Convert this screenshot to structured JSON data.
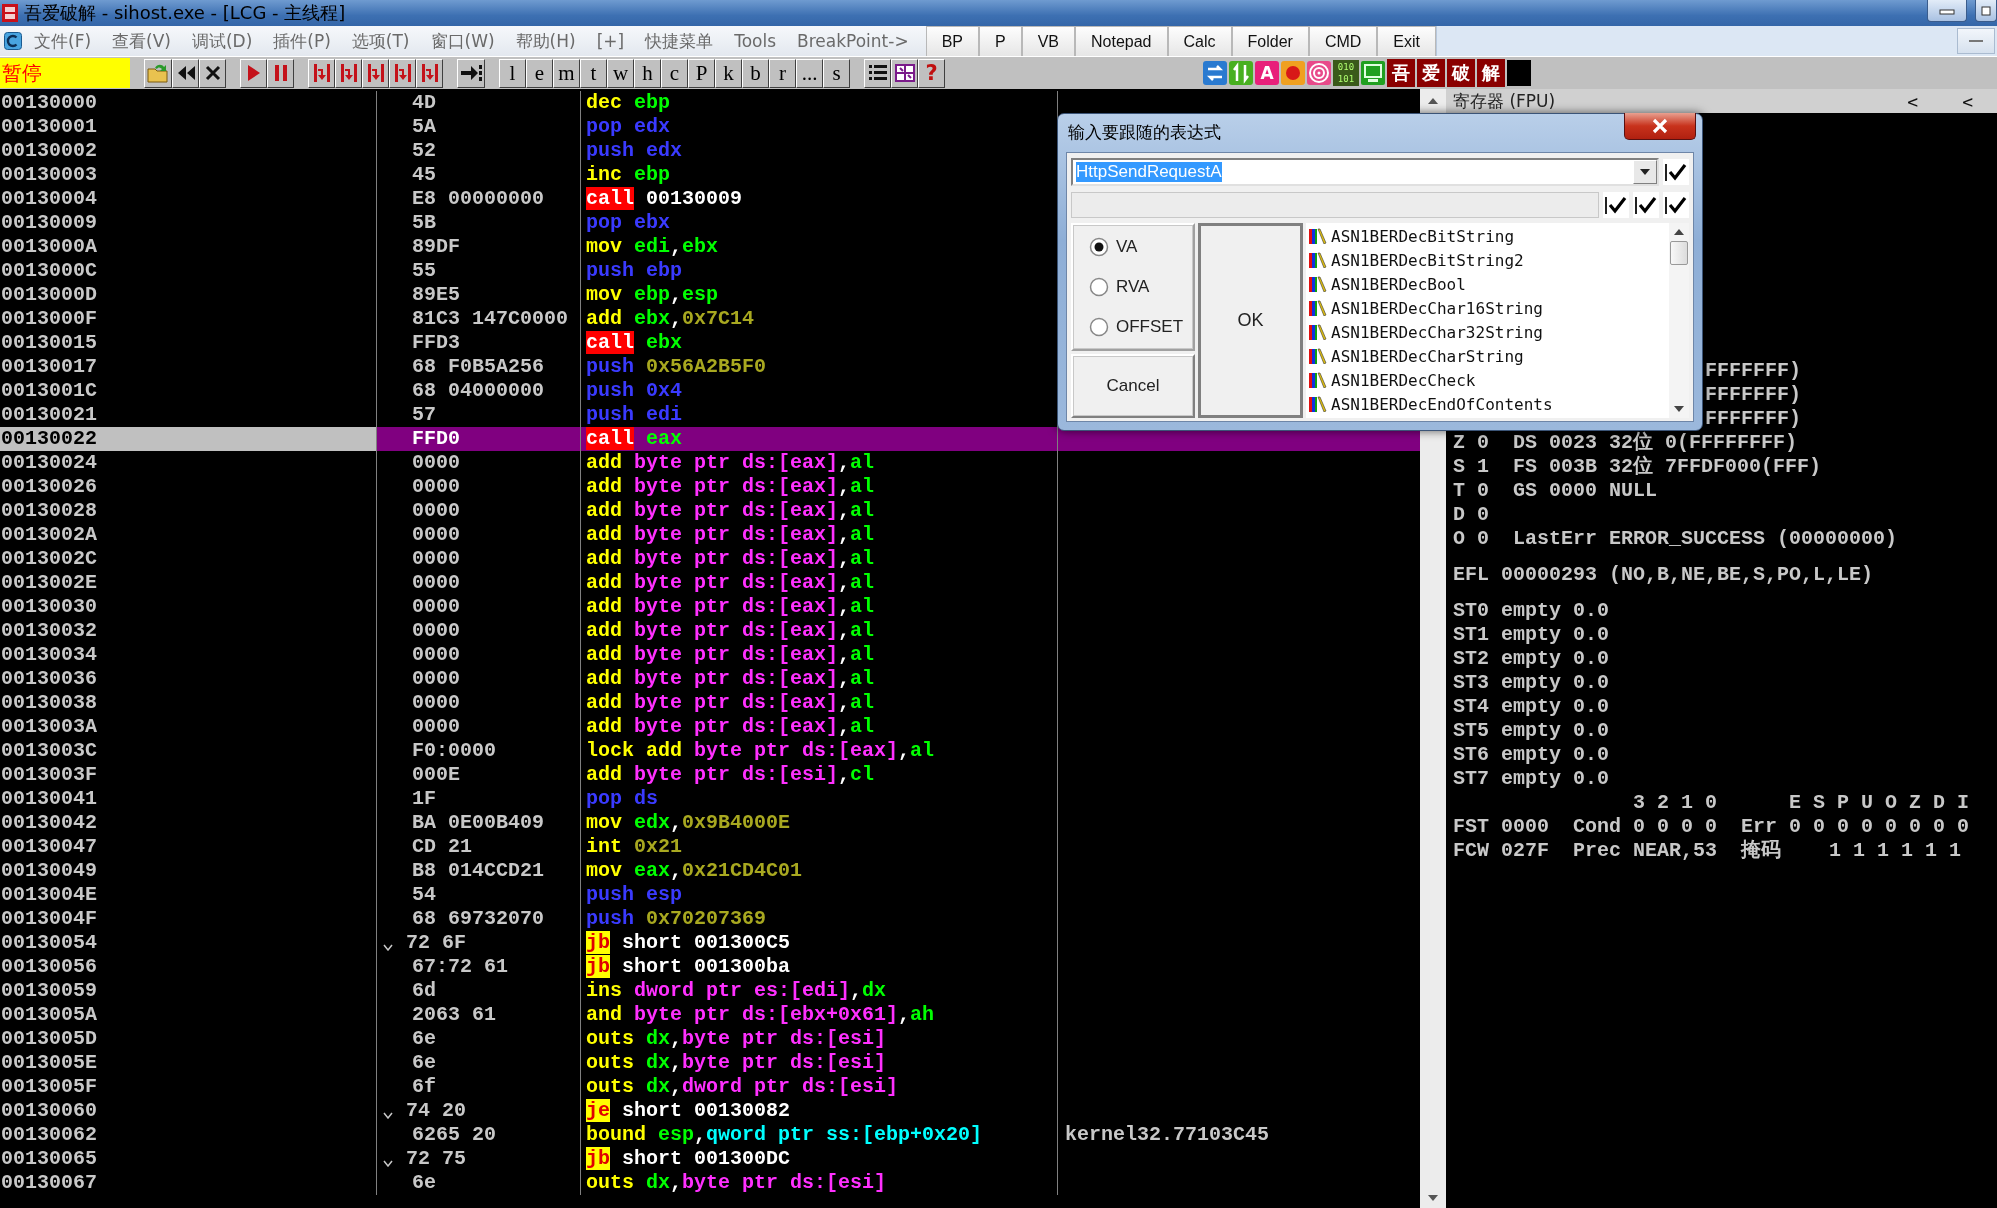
{
  "window": {
    "title": "吾爱破解 - sihost.exe - [LCG - 主线程]"
  },
  "menu": {
    "items": [
      "文件(F)",
      "查看(V)",
      "调试(D)",
      "插件(P)",
      "选项(T)",
      "窗口(W)",
      "帮助(H)",
      "[+]",
      "快捷菜单",
      "Tools",
      "BreakPoint->"
    ],
    "quick_buttons": [
      "BP",
      "P",
      "VB",
      "Notepad",
      "Calc",
      "Folder",
      "CMD",
      "Exit"
    ]
  },
  "toolbar": {
    "status": "暂停",
    "groups": [
      [
        {
          "kind": "open"
        },
        {
          "kind": "rewind"
        },
        {
          "kind": "stop"
        }
      ],
      [
        {
          "kind": "run"
        },
        {
          "kind": "pause"
        }
      ],
      [
        {
          "kind": "step"
        },
        {
          "kind": "step"
        },
        {
          "kind": "step"
        },
        {
          "kind": "step"
        },
        {
          "kind": "step"
        }
      ],
      [
        {
          "kind": "goto"
        }
      ],
      [
        {
          "kind": "letter",
          "label": "l"
        },
        {
          "kind": "letter",
          "label": "e"
        },
        {
          "kind": "letter",
          "label": "m"
        },
        {
          "kind": "letter",
          "label": "t"
        },
        {
          "kind": "letter",
          "label": "w"
        },
        {
          "kind": "letter",
          "label": "h"
        },
        {
          "kind": "letter",
          "label": "c"
        },
        {
          "kind": "letter",
          "label": "P"
        },
        {
          "kind": "letter",
          "label": "k"
        },
        {
          "kind": "letter",
          "label": "b"
        },
        {
          "kind": "letter",
          "label": "r"
        },
        {
          "kind": "letter",
          "label": "..."
        },
        {
          "kind": "letter",
          "label": "s"
        }
      ],
      [
        {
          "kind": "list"
        },
        {
          "kind": "grid"
        },
        {
          "kind": "help",
          "label": "?"
        }
      ]
    ],
    "plugins": [
      {
        "kind": "swap"
      },
      {
        "kind": "updown"
      },
      {
        "kind": "badge",
        "label": "A"
      },
      {
        "kind": "record"
      },
      {
        "kind": "target"
      },
      {
        "kind": "binary",
        "lines": [
          "010",
          "101"
        ]
      },
      {
        "kind": "panel"
      },
      {
        "kind": "hanzi",
        "label": "吾"
      },
      {
        "kind": "hanzi",
        "label": "爱"
      },
      {
        "kind": "hanzi",
        "label": "破"
      },
      {
        "kind": "hanzi",
        "label": "解"
      },
      {
        "kind": "blank"
      }
    ]
  },
  "disassembly": {
    "rows": [
      {
        "addr": "00130000",
        "hex": "4D",
        "branch": false,
        "selected": false,
        "ins": [
          {
            "kind": "op",
            "text": "dec "
          },
          {
            "kind": "reg",
            "text": "ebp"
          }
        ]
      },
      {
        "addr": "00130001",
        "hex": "5A",
        "branch": false,
        "selected": false,
        "ins": [
          {
            "kind": "stack",
            "text": "pop edx"
          }
        ]
      },
      {
        "addr": "00130002",
        "hex": "52",
        "branch": false,
        "selected": false,
        "ins": [
          {
            "kind": "stack",
            "text": "push edx"
          }
        ]
      },
      {
        "addr": "00130003",
        "hex": "45",
        "branch": false,
        "selected": false,
        "ins": [
          {
            "kind": "op",
            "text": "inc "
          },
          {
            "kind": "reg",
            "text": "ebp"
          }
        ]
      },
      {
        "addr": "00130004",
        "hex": "E8 00000000",
        "branch": false,
        "selected": false,
        "ins": [
          {
            "kind": "call",
            "text": "call"
          },
          {
            "kind": "text",
            "text": " 00130009"
          }
        ]
      },
      {
        "addr": "00130009",
        "hex": "5B",
        "branch": false,
        "selected": false,
        "ins": [
          {
            "kind": "stack",
            "text": "pop ebx"
          }
        ]
      },
      {
        "addr": "0013000A",
        "hex": "89DF",
        "branch": false,
        "selected": false,
        "ins": [
          {
            "kind": "op",
            "text": "mov "
          },
          {
            "kind": "reg",
            "text": "edi"
          },
          {
            "kind": "text",
            "text": ","
          },
          {
            "kind": "reg",
            "text": "ebx"
          }
        ]
      },
      {
        "addr": "0013000C",
        "hex": "55",
        "branch": false,
        "selected": false,
        "ins": [
          {
            "kind": "stack",
            "text": "push ebp"
          }
        ]
      },
      {
        "addr": "0013000D",
        "hex": "89E5",
        "branch": false,
        "selected": false,
        "ins": [
          {
            "kind": "op",
            "text": "mov "
          },
          {
            "kind": "reg",
            "text": "ebp"
          },
          {
            "kind": "text",
            "text": ","
          },
          {
            "kind": "reg",
            "text": "esp"
          }
        ]
      },
      {
        "addr": "0013000F",
        "hex": "81C3 147C0000",
        "branch": false,
        "selected": false,
        "ins": [
          {
            "kind": "op",
            "text": "add "
          },
          {
            "kind": "reg",
            "text": "ebx"
          },
          {
            "kind": "text",
            "text": ","
          },
          {
            "kind": "num",
            "text": "0x7C14"
          }
        ]
      },
      {
        "addr": "00130015",
        "hex": "FFD3",
        "branch": false,
        "selected": false,
        "ins": [
          {
            "kind": "call",
            "text": "call"
          },
          {
            "kind": "reg",
            "text": " ebx"
          }
        ]
      },
      {
        "addr": "00130017",
        "hex": "68 F0B5A256",
        "branch": false,
        "selected": false,
        "ins": [
          {
            "kind": "stack",
            "text": "push "
          },
          {
            "kind": "num",
            "text": "0x56A2B5F0"
          }
        ]
      },
      {
        "addr": "0013001C",
        "hex": "68 04000000",
        "branch": false,
        "selected": false,
        "ins": [
          {
            "kind": "stack",
            "text": "push 0x4"
          }
        ]
      },
      {
        "addr": "00130021",
        "hex": "57",
        "branch": false,
        "selected": false,
        "ins": [
          {
            "kind": "stack",
            "text": "push edi"
          }
        ]
      },
      {
        "addr": "00130022",
        "hex": "FFD0",
        "branch": false,
        "selected": true,
        "ins": [
          {
            "kind": "call",
            "text": "call"
          },
          {
            "kind": "reg",
            "text": " eax"
          }
        ]
      },
      {
        "addr": "00130024",
        "hex": "0000",
        "branch": false,
        "selected": false,
        "ins": [
          {
            "kind": "op",
            "text": "add "
          },
          {
            "kind": "mem",
            "text": "byte ptr ds:[eax]"
          },
          {
            "kind": "text",
            "text": ","
          },
          {
            "kind": "reg",
            "text": "al"
          }
        ]
      },
      {
        "addr": "00130026",
        "hex": "0000",
        "branch": false,
        "selected": false,
        "ins": [
          {
            "kind": "op",
            "text": "add "
          },
          {
            "kind": "mem",
            "text": "byte ptr ds:[eax]"
          },
          {
            "kind": "text",
            "text": ","
          },
          {
            "kind": "reg",
            "text": "al"
          }
        ]
      },
      {
        "addr": "00130028",
        "hex": "0000",
        "branch": false,
        "selected": false,
        "ins": [
          {
            "kind": "op",
            "text": "add "
          },
          {
            "kind": "mem",
            "text": "byte ptr ds:[eax]"
          },
          {
            "kind": "text",
            "text": ","
          },
          {
            "kind": "reg",
            "text": "al"
          }
        ]
      },
      {
        "addr": "0013002A",
        "hex": "0000",
        "branch": false,
        "selected": false,
        "ins": [
          {
            "kind": "op",
            "text": "add "
          },
          {
            "kind": "mem",
            "text": "byte ptr ds:[eax]"
          },
          {
            "kind": "text",
            "text": ","
          },
          {
            "kind": "reg",
            "text": "al"
          }
        ]
      },
      {
        "addr": "0013002C",
        "hex": "0000",
        "branch": false,
        "selected": false,
        "ins": [
          {
            "kind": "op",
            "text": "add "
          },
          {
            "kind": "mem",
            "text": "byte ptr ds:[eax]"
          },
          {
            "kind": "text",
            "text": ","
          },
          {
            "kind": "reg",
            "text": "al"
          }
        ]
      },
      {
        "addr": "0013002E",
        "hex": "0000",
        "branch": false,
        "selected": false,
        "ins": [
          {
            "kind": "op",
            "text": "add "
          },
          {
            "kind": "mem",
            "text": "byte ptr ds:[eax]"
          },
          {
            "kind": "text",
            "text": ","
          },
          {
            "kind": "reg",
            "text": "al"
          }
        ]
      },
      {
        "addr": "00130030",
        "hex": "0000",
        "branch": false,
        "selected": false,
        "ins": [
          {
            "kind": "op",
            "text": "add "
          },
          {
            "kind": "mem",
            "text": "byte ptr ds:[eax]"
          },
          {
            "kind": "text",
            "text": ","
          },
          {
            "kind": "reg",
            "text": "al"
          }
        ]
      },
      {
        "addr": "00130032",
        "hex": "0000",
        "branch": false,
        "selected": false,
        "ins": [
          {
            "kind": "op",
            "text": "add "
          },
          {
            "kind": "mem",
            "text": "byte ptr ds:[eax]"
          },
          {
            "kind": "text",
            "text": ","
          },
          {
            "kind": "reg",
            "text": "al"
          }
        ]
      },
      {
        "addr": "00130034",
        "hex": "0000",
        "branch": false,
        "selected": false,
        "ins": [
          {
            "kind": "op",
            "text": "add "
          },
          {
            "kind": "mem",
            "text": "byte ptr ds:[eax]"
          },
          {
            "kind": "text",
            "text": ","
          },
          {
            "kind": "reg",
            "text": "al"
          }
        ]
      },
      {
        "addr": "00130036",
        "hex": "0000",
        "branch": false,
        "selected": false,
        "ins": [
          {
            "kind": "op",
            "text": "add "
          },
          {
            "kind": "mem",
            "text": "byte ptr ds:[eax]"
          },
          {
            "kind": "text",
            "text": ","
          },
          {
            "kind": "reg",
            "text": "al"
          }
        ]
      },
      {
        "addr": "00130038",
        "hex": "0000",
        "branch": false,
        "selected": false,
        "ins": [
          {
            "kind": "op",
            "text": "add "
          },
          {
            "kind": "mem",
            "text": "byte ptr ds:[eax]"
          },
          {
            "kind": "text",
            "text": ","
          },
          {
            "kind": "reg",
            "text": "al"
          }
        ]
      },
      {
        "addr": "0013003A",
        "hex": "0000",
        "branch": false,
        "selected": false,
        "ins": [
          {
            "kind": "op",
            "text": "add "
          },
          {
            "kind": "mem",
            "text": "byte ptr ds:[eax]"
          },
          {
            "kind": "text",
            "text": ","
          },
          {
            "kind": "reg",
            "text": "al"
          }
        ]
      },
      {
        "addr": "0013003C",
        "hex": "F0:0000",
        "branch": false,
        "selected": false,
        "ins": [
          {
            "kind": "op",
            "text": "lock add "
          },
          {
            "kind": "mem",
            "text": "byte ptr ds:[eax]"
          },
          {
            "kind": "text",
            "text": ","
          },
          {
            "kind": "reg",
            "text": "al"
          }
        ]
      },
      {
        "addr": "0013003F",
        "hex": "000E",
        "branch": false,
        "selected": false,
        "ins": [
          {
            "kind": "op",
            "text": "add "
          },
          {
            "kind": "mem",
            "text": "byte ptr ds:[esi]"
          },
          {
            "kind": "text",
            "text": ","
          },
          {
            "kind": "reg",
            "text": "cl"
          }
        ]
      },
      {
        "addr": "00130041",
        "hex": "1F",
        "branch": false,
        "selected": false,
        "ins": [
          {
            "kind": "stack",
            "text": "pop ds"
          }
        ]
      },
      {
        "addr": "00130042",
        "hex": "BA 0E00B409",
        "branch": false,
        "selected": false,
        "ins": [
          {
            "kind": "op",
            "text": "mov "
          },
          {
            "kind": "reg",
            "text": "edx"
          },
          {
            "kind": "text",
            "text": ","
          },
          {
            "kind": "num",
            "text": "0x9B4000E"
          }
        ]
      },
      {
        "addr": "00130047",
        "hex": "CD 21",
        "branch": false,
        "selected": false,
        "ins": [
          {
            "kind": "op",
            "text": "int "
          },
          {
            "kind": "num",
            "text": "0x21"
          }
        ]
      },
      {
        "addr": "00130049",
        "hex": "B8 014CCD21",
        "branch": false,
        "selected": false,
        "ins": [
          {
            "kind": "op",
            "text": "mov "
          },
          {
            "kind": "reg",
            "text": "eax"
          },
          {
            "kind": "text",
            "text": ","
          },
          {
            "kind": "num",
            "text": "0x21CD4C01"
          }
        ]
      },
      {
        "addr": "0013004E",
        "hex": "54",
        "branch": false,
        "selected": false,
        "ins": [
          {
            "kind": "stack",
            "text": "push esp"
          }
        ]
      },
      {
        "addr": "0013004F",
        "hex": "68 69732070",
        "branch": false,
        "selected": false,
        "ins": [
          {
            "kind": "stack",
            "text": "push "
          },
          {
            "kind": "num",
            "text": "0x70207369"
          }
        ]
      },
      {
        "addr": "00130054",
        "hex": "72 6F",
        "branch": true,
        "selected": false,
        "ins": [
          {
            "kind": "jump",
            "text": "jb"
          },
          {
            "kind": "text",
            "text": " short 001300C5"
          }
        ]
      },
      {
        "addr": "00130056",
        "hex": "67:72 61",
        "branch": false,
        "selected": false,
        "ins": [
          {
            "kind": "jump",
            "text": "jb"
          },
          {
            "kind": "text",
            "text": " short 001300ba"
          }
        ]
      },
      {
        "addr": "00130059",
        "hex": "6d",
        "branch": false,
        "selected": false,
        "ins": [
          {
            "kind": "op",
            "text": "ins "
          },
          {
            "kind": "mem",
            "text": "dword ptr es:[edi]"
          },
          {
            "kind": "text",
            "text": ","
          },
          {
            "kind": "reg",
            "text": "dx"
          }
        ]
      },
      {
        "addr": "0013005A",
        "hex": "2063 61",
        "branch": false,
        "selected": false,
        "ins": [
          {
            "kind": "op",
            "text": "and "
          },
          {
            "kind": "mem",
            "text": "byte ptr ds:[ebx+0x61]"
          },
          {
            "kind": "text",
            "text": ","
          },
          {
            "kind": "reg",
            "text": "ah"
          }
        ]
      },
      {
        "addr": "0013005D",
        "hex": "6e",
        "branch": false,
        "selected": false,
        "ins": [
          {
            "kind": "op",
            "text": "outs "
          },
          {
            "kind": "reg",
            "text": "dx"
          },
          {
            "kind": "text",
            "text": ","
          },
          {
            "kind": "mem",
            "text": "byte ptr ds:[esi]"
          }
        ]
      },
      {
        "addr": "0013005E",
        "hex": "6e",
        "branch": false,
        "selected": false,
        "ins": [
          {
            "kind": "op",
            "text": "outs "
          },
          {
            "kind": "reg",
            "text": "dx"
          },
          {
            "kind": "text",
            "text": ","
          },
          {
            "kind": "mem",
            "text": "byte ptr ds:[esi]"
          }
        ]
      },
      {
        "addr": "0013005F",
        "hex": "6f",
        "branch": false,
        "selected": false,
        "ins": [
          {
            "kind": "op",
            "text": "outs "
          },
          {
            "kind": "reg",
            "text": "dx"
          },
          {
            "kind": "text",
            "text": ","
          },
          {
            "kind": "mem",
            "text": "dword ptr ds:[esi]"
          }
        ]
      },
      {
        "addr": "00130060",
        "hex": "74 20",
        "branch": true,
        "selected": false,
        "ins": [
          {
            "kind": "jump",
            "text": "je"
          },
          {
            "kind": "text",
            "text": " short 00130082"
          }
        ]
      },
      {
        "addr": "00130062",
        "hex": "6265 20",
        "branch": false,
        "selected": false,
        "ins": [
          {
            "kind": "op",
            "text": "bound "
          },
          {
            "kind": "reg",
            "text": "esp"
          },
          {
            "kind": "text",
            "text": ","
          },
          {
            "kind": "segmem",
            "text": "qword ptr ss:[ebp+0x20]"
          }
        ],
        "comment": "kernel32.77103C45"
      },
      {
        "addr": "00130065",
        "hex": "72 75",
        "branch": true,
        "selected": false,
        "ins": [
          {
            "kind": "jump",
            "text": "jb"
          },
          {
            "kind": "text",
            "text": " short 001300DC"
          }
        ]
      },
      {
        "addr": "00130067",
        "hex": "6e",
        "branch": false,
        "selected": false,
        "ins": [
          {
            "kind": "op",
            "text": "outs "
          },
          {
            "kind": "reg",
            "text": "dx"
          },
          {
            "kind": "text",
            "text": ","
          },
          {
            "kind": "mem",
            "text": "byte ptr ds:[esi]"
          }
        ]
      }
    ]
  },
  "registers": {
    "title": "寄存器 (FPU)",
    "nav": [
      "<",
      "<"
    ],
    "groups": [
      [
        {
          "kind": "partial",
          "text": "FFFFFFF)"
        },
        {
          "kind": "partial",
          "text": "FFFFFFF)"
        },
        {
          "kind": "partial",
          "text": "FFFFFFF)"
        },
        {
          "kind": "line",
          "text": "Z 0  DS 0023 32位 0(FFFFFFFF)"
        },
        {
          "kind": "line",
          "text": "S 1  FS 003B 32位 7FFDF000(FFF)"
        },
        {
          "kind": "line",
          "text": "T 0  GS 0000 NULL"
        },
        {
          "kind": "line",
          "text": "D 0"
        },
        {
          "kind": "line",
          "text": "O 0  LastErr ERROR_SUCCESS (00000000)"
        }
      ],
      [
        {
          "kind": "line",
          "text": "EFL 00000293 (NO,B,NE,BE,S,PO,L,LE)"
        }
      ],
      [
        {
          "kind": "line",
          "text": "ST0 empty 0.0"
        },
        {
          "kind": "line",
          "text": "ST1 empty 0.0"
        },
        {
          "kind": "line",
          "text": "ST2 empty 0.0"
        },
        {
          "kind": "line",
          "text": "ST3 empty 0.0"
        },
        {
          "kind": "line",
          "text": "ST4 empty 0.0"
        },
        {
          "kind": "line",
          "text": "ST5 empty 0.0"
        },
        {
          "kind": "line",
          "text": "ST6 empty 0.0"
        },
        {
          "kind": "line",
          "text": "ST7 empty 0.0"
        },
        {
          "kind": "line",
          "text": "               3 2 1 0      E S P U O Z D I"
        },
        {
          "kind": "line",
          "text": "FST 0000  Cond 0 0 0 0  Err 0 0 0 0 0 0 0 0"
        },
        {
          "kind": "line",
          "text": "FCW 027F  Prec NEAR,53  掩码    1 1 1 1 1 1"
        }
      ]
    ]
  },
  "dialog": {
    "title": "输入要跟随的表达式",
    "expression": "HttpSendRequestA",
    "expression_selected": true,
    "toggles": [
      {
        "checked": true
      }
    ],
    "options": [
      {
        "checked": true
      },
      {
        "checked": true
      },
      {
        "checked": true
      }
    ],
    "address_modes": [
      {
        "label": "VA",
        "selected": true
      },
      {
        "label": "RVA",
        "selected": false
      },
      {
        "label": "OFFSET",
        "selected": false
      }
    ],
    "ok": "OK",
    "cancel": "Cancel",
    "symbols": [
      "ASN1BERDecBitString",
      "ASN1BERDecBitString2",
      "ASN1BERDecBool",
      "ASN1BERDecChar16String",
      "ASN1BERDecChar32String",
      "ASN1BERDecCharString",
      "ASN1BERDecCheck",
      "ASN1BERDecEndOfContents"
    ]
  }
}
